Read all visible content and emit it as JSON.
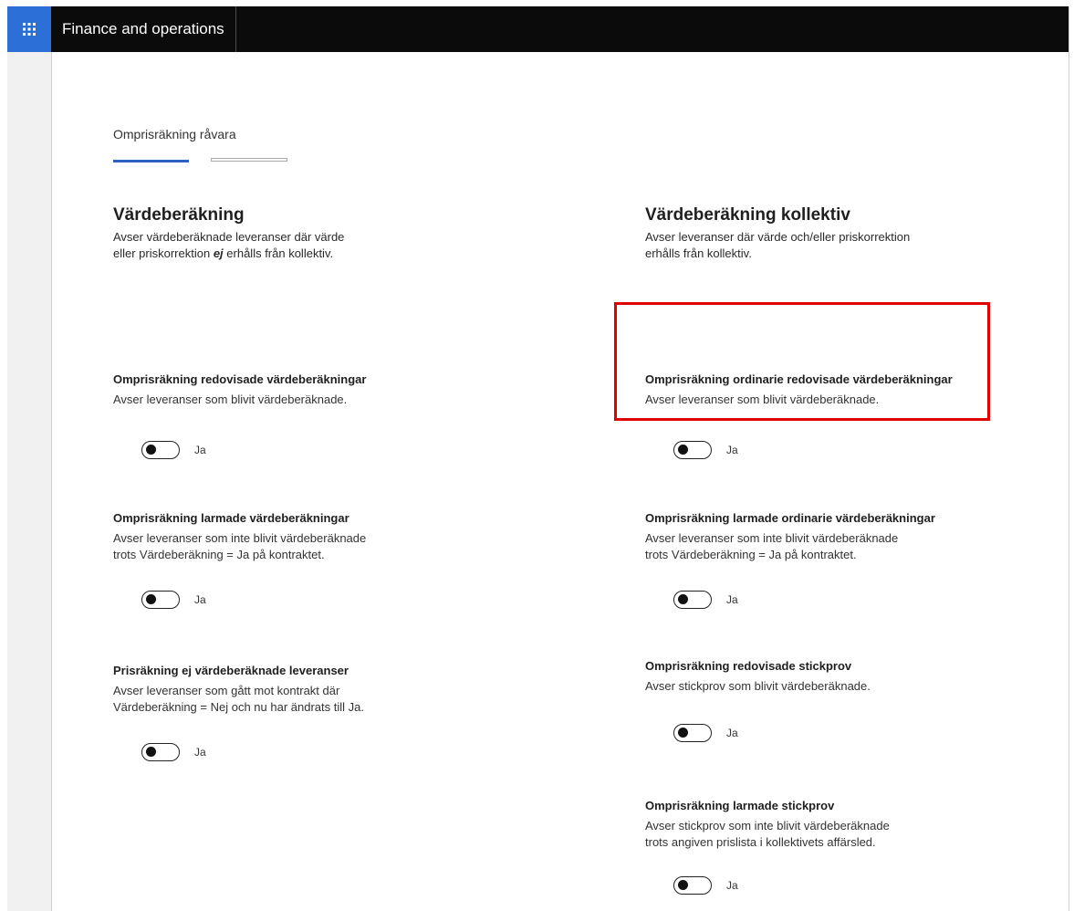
{
  "header": {
    "app_title": "Finance and operations"
  },
  "page": {
    "tab_label": "Omprisräkning råvara",
    "progress": {
      "current_step": 1,
      "total_steps": 2
    }
  },
  "left_section": {
    "heading": "Värdeberäkning",
    "description_line1": "Avser värdeberäknade leveranser där värde",
    "description_line2_pre": "eller priskorrektion ",
    "description_line2_em": "ej",
    "description_line2_post": " erhålls från kollektiv.",
    "settings": [
      {
        "title": "Omprisräkning redovisade värdeberäkningar",
        "desc_line1": "Avser leveranser som blivit värdeberäknade.",
        "desc_line2": "",
        "toggle_label": "Ja"
      },
      {
        "title": "Omprisräkning larmade värdeberäkningar",
        "desc_line1": "Avser leveranser som inte blivit värdeberäknade",
        "desc_line2": "trots Värdeberäkning = Ja på kontraktet.",
        "toggle_label": "Ja"
      },
      {
        "title": "Prisräkning ej värdeberäknade leveranser",
        "desc_line1": "Avser leveranser som gått mot kontrakt där",
        "desc_line2": "Värdeberäkning = Nej och nu har ändrats till Ja.",
        "toggle_label": "Ja"
      }
    ]
  },
  "right_section": {
    "heading": "Värdeberäkning kollektiv",
    "description_line1": "Avser leveranser där värde och/eller priskorrektion",
    "description_line2": "erhålls från kollektiv.",
    "settings": [
      {
        "title": "Omprisräkning ordinarie redovisade värdeberäkningar",
        "desc_line1": "Avser leveranser som blivit värdeberäknade.",
        "desc_line2": "",
        "toggle_label": "Ja"
      },
      {
        "title": "Omprisräkning larmade ordinarie värdeberäkningar",
        "desc_line1": "Avser leveranser som inte blivit värdeberäknade",
        "desc_line2": "trots Värdeberäkning = Ja på kontraktet.",
        "toggle_label": "Ja"
      },
      {
        "title": "Omprisräkning redovisade stickprov",
        "desc_line1": "Avser stickprov som blivit värdeberäknade.",
        "desc_line2": "",
        "toggle_label": "Ja"
      },
      {
        "title": "Omprisräkning larmade stickprov",
        "desc_line1": "Avser stickprov som inte blivit värdeberäknade",
        "desc_line2": "trots angiven prislista i kollektivets affärsled.",
        "toggle_label": "Ja"
      }
    ]
  },
  "colors": {
    "topbar": "#0b0b0b",
    "waffle": "#2c6fd6",
    "progress_active": "#2f5fc1",
    "highlight": "#e00000"
  },
  "icons": {
    "app_launcher": "waffle-grid-icon"
  }
}
